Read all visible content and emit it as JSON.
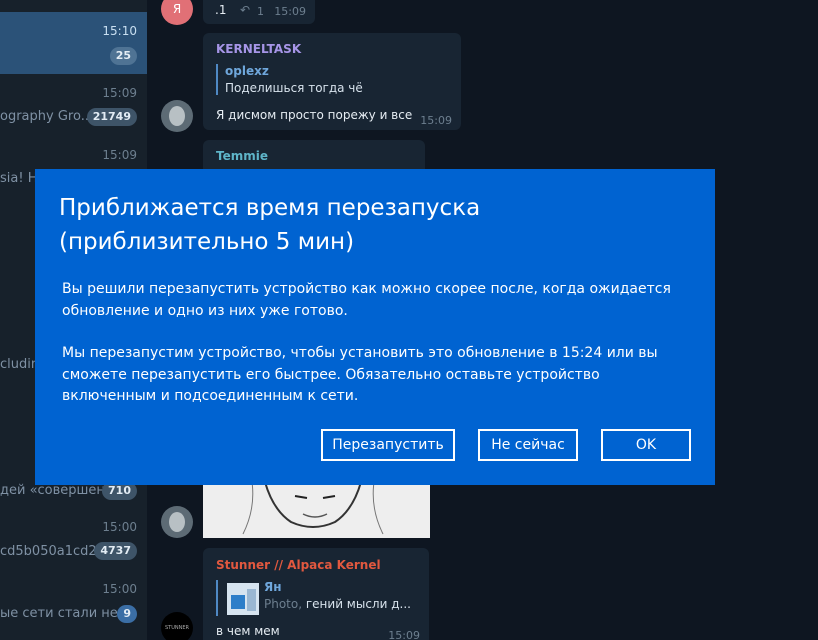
{
  "sidebar": {
    "chats": [
      {
        "preview": "",
        "time": "15:10",
        "badge": "25"
      },
      {
        "preview": "ography Gro...",
        "time": "15:09",
        "badge": "21749"
      },
      {
        "preview": "sia! Hc",
        "time": "15:09"
      },
      {
        "preview": "cluding"
      },
      {
        "preview": "дей «совершен...",
        "badge": "710"
      },
      {
        "preview": "cd5b050a1cd2...",
        "time": "15:00",
        "badge": "4737"
      },
      {
        "preview": "ые сети стали не...",
        "time": "15:00",
        "badge": "9"
      }
    ]
  },
  "messages": {
    "m1": {
      "avatar_letter": "Я",
      "text": ".1",
      "reply_count": "1",
      "time": "15:09"
    },
    "m2": {
      "sender": "KERNELTASK",
      "quote_name": "oplexz",
      "quote_text": "Поделишься тогда чё",
      "text": "Я дисмом просто порежу и все",
      "time": "15:09"
    },
    "m3": {
      "sender": "Temmie"
    },
    "m5": {
      "sender": "Stunner // Alpaca Kernel",
      "quote_name": "Ян",
      "quote_prefix": "Photo, ",
      "quote_text": "гений мысли д...",
      "text": "в чем мем",
      "time": "15:09",
      "avatar_text": "STUNNER"
    }
  },
  "dialog": {
    "title": "Приближается время перезапуска (приблизительно 5 мин)",
    "paragraph1": "Вы решили перезапустить устройство как можно скорее после, когда ожидается обновление и одно из них уже готово.",
    "paragraph2": "Мы перезапустим устройство, чтобы установить это обновление в 15:24 или вы сможете перезапустить его быстрее. Обязательно оставьте устройство включенным и подсоединенным к сети.",
    "buttons": {
      "restart": "Перезапустить",
      "not_now": "Не сейчас",
      "ok": "OK"
    }
  },
  "colors": {
    "dialog_bg": "#0063d1",
    "app_bg": "#0e1621",
    "sidebar_bg": "#17212b",
    "active_chat": "#2b5278",
    "sender_purple": "#a695e7",
    "sender_teal": "#5eb5c9",
    "sender_red": "#e1583f"
  }
}
